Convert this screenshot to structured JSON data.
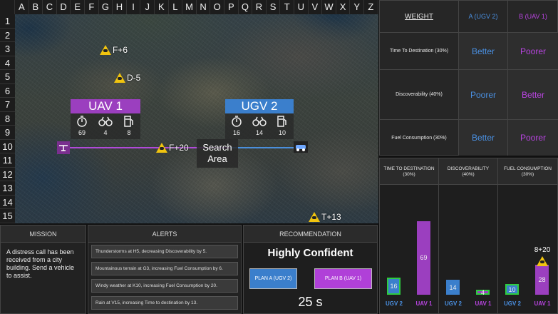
{
  "grid": {
    "columns": [
      "A",
      "B",
      "C",
      "D",
      "E",
      "F",
      "G",
      "H",
      "I",
      "J",
      "K",
      "L",
      "M",
      "N",
      "O",
      "P",
      "Q",
      "R",
      "S",
      "T",
      "U",
      "V",
      "W",
      "X",
      "Y",
      "Z"
    ],
    "rows": [
      "1",
      "2",
      "3",
      "4",
      "5",
      "6",
      "7",
      "8",
      "9",
      "10",
      "11",
      "12",
      "13",
      "14",
      "15"
    ]
  },
  "map": {
    "weather_markers": [
      {
        "label": "F+6"
      },
      {
        "label": "D-5"
      },
      {
        "label": "F+20"
      },
      {
        "label": "T+13"
      }
    ],
    "search_area": "Search\nArea",
    "units": {
      "uav": {
        "name": "UAV 1",
        "time": "69",
        "discoverability": "4",
        "fuel": "8"
      },
      "ugv": {
        "name": "UGV 2",
        "time": "16",
        "discoverability": "14",
        "fuel": "10"
      }
    }
  },
  "comparison": {
    "header": {
      "weight": "WEIGHT",
      "plan_a": "A (UGV 2)",
      "plan_b": "B (UAV 1)"
    },
    "rows": [
      {
        "criterion": "Time To Destination (30%)",
        "a": "Better",
        "b": "Poorer"
      },
      {
        "criterion": "Discoverability (40%)",
        "a": "Poorer",
        "b": "Better"
      },
      {
        "criterion": "Fuel Consumption (30%)",
        "a": "Better",
        "b": "Poorer"
      }
    ]
  },
  "bars": {
    "groups": [
      {
        "title": "TIME TO DESTINATION\n(30%)",
        "ugv": 16,
        "uav": 69
      },
      {
        "title": "DISCOVERABILITY\n(40%)",
        "ugv": 14,
        "uav": 4
      },
      {
        "title": "FUEL CONSUMPTION\n(30%)",
        "ugv": 10,
        "uav": 28
      }
    ],
    "ugv_label": "UGV 2",
    "uav_label": "UAV 1",
    "fuel_annotation": "8+20"
  },
  "mission": {
    "title": "MISSION",
    "text": "A distress call has been received from a city building. Send a vehicle to assist."
  },
  "alerts": {
    "title": "ALERTS",
    "items": [
      "Thunderstorms at H5, decreasing Discoverability by 5.",
      "Mountainous terrain at G3, increasing Fuel Consumption by 6.",
      "Windy weather at K10, increasing Fuel Consumption by 20.",
      "Rain at V15, increasing Time to destination by 13."
    ]
  },
  "recommendation": {
    "title": "RECOMMENDATION",
    "confidence": "Highly Confident",
    "plan_a_label": "PLAN A (UGV 2)",
    "plan_b_label": "PLAN B (UAV 1)",
    "timer": "25 s"
  },
  "colors": {
    "ugv": "#3b7fcc",
    "uav": "#9b3fbf",
    "plan_a_text": "#4a90e2",
    "plan_b_text": "#b844e0",
    "route": "#b04ad8",
    "route_ugv": "#4a8fdc",
    "warning": "#f1c40f"
  }
}
